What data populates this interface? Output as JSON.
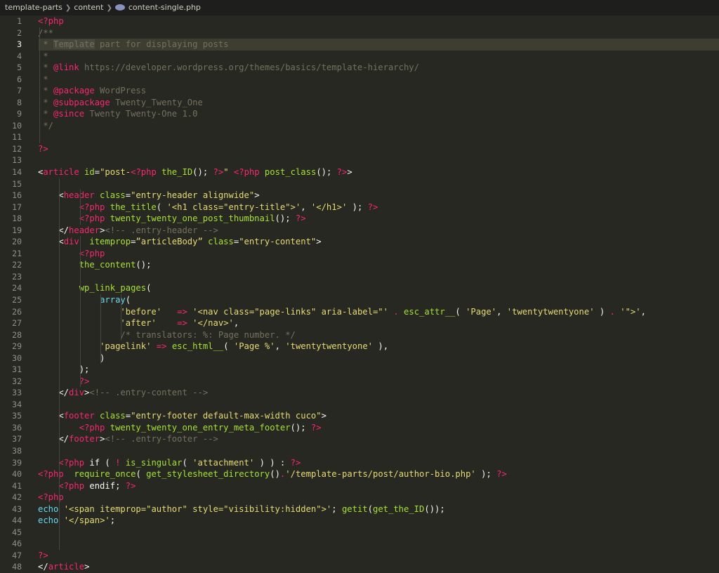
{
  "breadcrumb": {
    "items": [
      "template-parts",
      "content",
      "content-single.php"
    ]
  },
  "editor": {
    "current_line": 3,
    "lines": [
      {
        "n": "1",
        "tokens": [
          [
            "tag",
            "<?php"
          ]
        ]
      },
      {
        "n": "2",
        "tokens": [
          [
            "cm",
            "/**"
          ]
        ]
      },
      {
        "n": "3",
        "tokens": [
          [
            "cm",
            " * "
          ],
          [
            "cm sel",
            "Template"
          ],
          [
            "cm",
            " part for displaying posts"
          ]
        ]
      },
      {
        "n": "4",
        "tokens": [
          [
            "cm",
            " *"
          ]
        ]
      },
      {
        "n": "5",
        "tokens": [
          [
            "cm",
            " * "
          ],
          [
            "tag",
            "@link"
          ],
          [
            "cm",
            " https://developer.wordpress.org/themes/basics/template-hierarchy/"
          ]
        ]
      },
      {
        "n": "6",
        "tokens": [
          [
            "cm",
            " *"
          ]
        ]
      },
      {
        "n": "7",
        "tokens": [
          [
            "cm",
            " * "
          ],
          [
            "tag",
            "@package"
          ],
          [
            "cm",
            " WordPress"
          ]
        ]
      },
      {
        "n": "8",
        "tokens": [
          [
            "cm",
            " * "
          ],
          [
            "tag",
            "@subpackage"
          ],
          [
            "cm",
            " Twenty_Twenty_One"
          ]
        ]
      },
      {
        "n": "9",
        "tokens": [
          [
            "cm",
            " * "
          ],
          [
            "tag",
            "@since"
          ],
          [
            "cm",
            " Twenty Twenty-One 1.0"
          ]
        ]
      },
      {
        "n": "10",
        "tokens": [
          [
            "cm",
            " */"
          ]
        ]
      },
      {
        "n": "11",
        "tokens": []
      },
      {
        "n": "12",
        "tokens": [
          [
            "tag",
            "?>"
          ]
        ]
      },
      {
        "n": "13",
        "tokens": []
      },
      {
        "n": "14",
        "tokens": [
          [
            "plain",
            "<"
          ],
          [
            "tag",
            "article"
          ],
          [
            "attr",
            " id"
          ],
          [
            "plain",
            "="
          ],
          [
            "str",
            "\"post-"
          ],
          [
            "tag",
            "<?php"
          ],
          [
            "fn",
            " the_ID"
          ],
          [
            "plain",
            "(); "
          ],
          [
            "tag",
            "?>"
          ],
          [
            "str",
            "\""
          ],
          [
            "tag",
            " <?php"
          ],
          [
            "fn",
            " post_class"
          ],
          [
            "plain",
            "(); "
          ],
          [
            "tag",
            "?>"
          ],
          [
            "plain",
            ">"
          ]
        ]
      },
      {
        "n": "15",
        "tokens": []
      },
      {
        "n": "16",
        "tokens": [
          [
            "plain",
            "    <"
          ],
          [
            "tag",
            "header"
          ],
          [
            "attr",
            " class"
          ],
          [
            "plain",
            "="
          ],
          [
            "str",
            "\"entry-header alignwide\""
          ],
          [
            "plain",
            ">"
          ]
        ]
      },
      {
        "n": "17",
        "tokens": [
          [
            "plain",
            "        "
          ],
          [
            "tag",
            "<?php"
          ],
          [
            "fn",
            " the_title"
          ],
          [
            "plain",
            "( "
          ],
          [
            "str",
            "'<h1 class=\"entry-title\">'"
          ],
          [
            "plain",
            ", "
          ],
          [
            "str",
            "'</h1>'"
          ],
          [
            "plain",
            " ); "
          ],
          [
            "tag",
            "?>"
          ]
        ]
      },
      {
        "n": "18",
        "tokens": [
          [
            "plain",
            "        "
          ],
          [
            "tag",
            "<?php"
          ],
          [
            "fn",
            " twenty_twenty_one_post_thumbnail"
          ],
          [
            "plain",
            "(); "
          ],
          [
            "tag",
            "?>"
          ]
        ]
      },
      {
        "n": "19",
        "tokens": [
          [
            "plain",
            "    </"
          ],
          [
            "tag",
            "header"
          ],
          [
            "plain",
            ">"
          ],
          [
            "cm",
            "<!-- .entry-header -->"
          ]
        ]
      },
      {
        "n": "20",
        "tokens": [
          [
            "plain",
            "    <"
          ],
          [
            "tag",
            "div"
          ],
          [
            "attr",
            "  itemprop"
          ],
          [
            "plain",
            "="
          ],
          [
            "str",
            "”articleBody”"
          ],
          [
            "attr",
            " class"
          ],
          [
            "plain",
            "="
          ],
          [
            "str",
            "\"entry-content\""
          ],
          [
            "plain",
            ">"
          ]
        ]
      },
      {
        "n": "21",
        "tokens": [
          [
            "plain",
            "        "
          ],
          [
            "tag",
            "<?php"
          ]
        ]
      },
      {
        "n": "22",
        "tokens": [
          [
            "plain",
            "        "
          ],
          [
            "fn",
            "the_content"
          ],
          [
            "plain",
            "();"
          ]
        ]
      },
      {
        "n": "23",
        "tokens": []
      },
      {
        "n": "24",
        "tokens": [
          [
            "plain",
            "        "
          ],
          [
            "fn",
            "wp_link_pages"
          ],
          [
            "plain",
            "("
          ]
        ]
      },
      {
        "n": "25",
        "tokens": [
          [
            "plain",
            "            "
          ],
          [
            "kw",
            "array"
          ],
          [
            "plain",
            "("
          ]
        ]
      },
      {
        "n": "26",
        "tokens": [
          [
            "plain",
            "                "
          ],
          [
            "str",
            "'before'"
          ],
          [
            "plain",
            "   "
          ],
          [
            "tag",
            "=>"
          ],
          [
            "plain",
            " "
          ],
          [
            "str",
            "'<nav class=\"page-links\" aria-label=\"'"
          ],
          [
            "plain",
            " "
          ],
          [
            "tag",
            "."
          ],
          [
            "plain",
            " "
          ],
          [
            "fn",
            "esc_attr__"
          ],
          [
            "plain",
            "( "
          ],
          [
            "str",
            "'Page'"
          ],
          [
            "plain",
            ", "
          ],
          [
            "str",
            "'twentytwentyone'"
          ],
          [
            "plain",
            " ) "
          ],
          [
            "tag",
            "."
          ],
          [
            "plain",
            " "
          ],
          [
            "str",
            "'\">'"
          ],
          [
            "plain",
            ","
          ]
        ]
      },
      {
        "n": "27",
        "tokens": [
          [
            "plain",
            "                "
          ],
          [
            "str",
            "'after'"
          ],
          [
            "plain",
            "    "
          ],
          [
            "tag",
            "=>"
          ],
          [
            "plain",
            " "
          ],
          [
            "str",
            "'</nav>'"
          ],
          [
            "plain",
            ","
          ]
        ]
      },
      {
        "n": "28",
        "tokens": [
          [
            "plain",
            "                "
          ],
          [
            "cm",
            "/* translators: %: Page number. */"
          ]
        ]
      },
      {
        "n": "29",
        "tokens": [
          [
            "plain",
            "            "
          ],
          [
            "str",
            "'pagelink'"
          ],
          [
            "plain",
            " "
          ],
          [
            "tag",
            "=>"
          ],
          [
            "plain",
            " "
          ],
          [
            "fn",
            "esc_html__"
          ],
          [
            "plain",
            "( "
          ],
          [
            "str",
            "'Page %'"
          ],
          [
            "plain",
            ", "
          ],
          [
            "str",
            "'twentytwentyone'"
          ],
          [
            "plain",
            " ),"
          ]
        ]
      },
      {
        "n": "30",
        "tokens": [
          [
            "plain",
            "            )"
          ]
        ]
      },
      {
        "n": "31",
        "tokens": [
          [
            "plain",
            "        );"
          ]
        ]
      },
      {
        "n": "32",
        "tokens": [
          [
            "plain",
            "        "
          ],
          [
            "tag",
            "?>"
          ]
        ]
      },
      {
        "n": "33",
        "tokens": [
          [
            "plain",
            "    </"
          ],
          [
            "tag",
            "div"
          ],
          [
            "plain",
            ">"
          ],
          [
            "cm",
            "<!-- .entry-content -->"
          ]
        ]
      },
      {
        "n": "34",
        "tokens": []
      },
      {
        "n": "35",
        "tokens": [
          [
            "plain",
            "    <"
          ],
          [
            "tag",
            "footer"
          ],
          [
            "attr",
            " class"
          ],
          [
            "plain",
            "="
          ],
          [
            "str",
            "\"entry-footer default-max-width cuco\""
          ],
          [
            "plain",
            ">"
          ]
        ]
      },
      {
        "n": "36",
        "tokens": [
          [
            "plain",
            "        "
          ],
          [
            "tag",
            "<?php"
          ],
          [
            "fn",
            " twenty_twenty_one_entry_meta_footer"
          ],
          [
            "plain",
            "(); "
          ],
          [
            "tag",
            "?>"
          ]
        ]
      },
      {
        "n": "37",
        "tokens": [
          [
            "plain",
            "    </"
          ],
          [
            "tag",
            "footer"
          ],
          [
            "plain",
            ">"
          ],
          [
            "cm",
            "<!-- .entry-footer -->"
          ]
        ]
      },
      {
        "n": "38",
        "tokens": []
      },
      {
        "n": "39",
        "tokens": [
          [
            "plain",
            "    "
          ],
          [
            "tag",
            "<?php"
          ],
          [
            "plain",
            " if ( "
          ],
          [
            "tag",
            "!"
          ],
          [
            "plain",
            " "
          ],
          [
            "fn",
            "is_singular"
          ],
          [
            "plain",
            "( "
          ],
          [
            "str",
            "'attachment'"
          ],
          [
            "plain",
            " ) ) : "
          ],
          [
            "tag",
            "?>"
          ]
        ]
      },
      {
        "n": "40",
        "tokens": [
          [
            "tag",
            "<?php"
          ],
          [
            "plain",
            "  "
          ],
          [
            "fn",
            "require_once"
          ],
          [
            "plain",
            "( "
          ],
          [
            "fn",
            "get_stylesheet_directory"
          ],
          [
            "plain",
            "()"
          ],
          [
            "tag",
            "."
          ],
          [
            "str",
            "'/template-parts/post/author-bio.php'"
          ],
          [
            "plain",
            " ); "
          ],
          [
            "tag",
            "?>"
          ]
        ]
      },
      {
        "n": "41",
        "tokens": [
          [
            "plain",
            "    "
          ],
          [
            "tag",
            "<?php"
          ],
          [
            "plain",
            " endif; "
          ],
          [
            "tag",
            "?>"
          ]
        ]
      },
      {
        "n": "42",
        "tokens": [
          [
            "tag",
            "<?php"
          ]
        ]
      },
      {
        "n": "43",
        "tokens": [
          [
            "kw",
            "echo"
          ],
          [
            "plain",
            " "
          ],
          [
            "str",
            "'<span itemprop=\"author\" style=\"visibility:hidden\">'"
          ],
          [
            "plain",
            "; "
          ],
          [
            "fn",
            "getit"
          ],
          [
            "plain",
            "("
          ],
          [
            "fn",
            "get_the_ID"
          ],
          [
            "plain",
            "());"
          ]
        ]
      },
      {
        "n": "44",
        "tokens": [
          [
            "kw",
            "echo"
          ],
          [
            "plain",
            " "
          ],
          [
            "str",
            "'</span>'"
          ],
          [
            "plain",
            ";"
          ]
        ]
      },
      {
        "n": "45",
        "tokens": []
      },
      {
        "n": "46",
        "tokens": []
      },
      {
        "n": "47",
        "tokens": [
          [
            "tag",
            "?>"
          ]
        ]
      },
      {
        "n": "48",
        "tokens": [
          [
            "plain",
            "</"
          ],
          [
            "tag",
            "article"
          ],
          [
            "plain",
            ">"
          ]
        ]
      }
    ]
  }
}
